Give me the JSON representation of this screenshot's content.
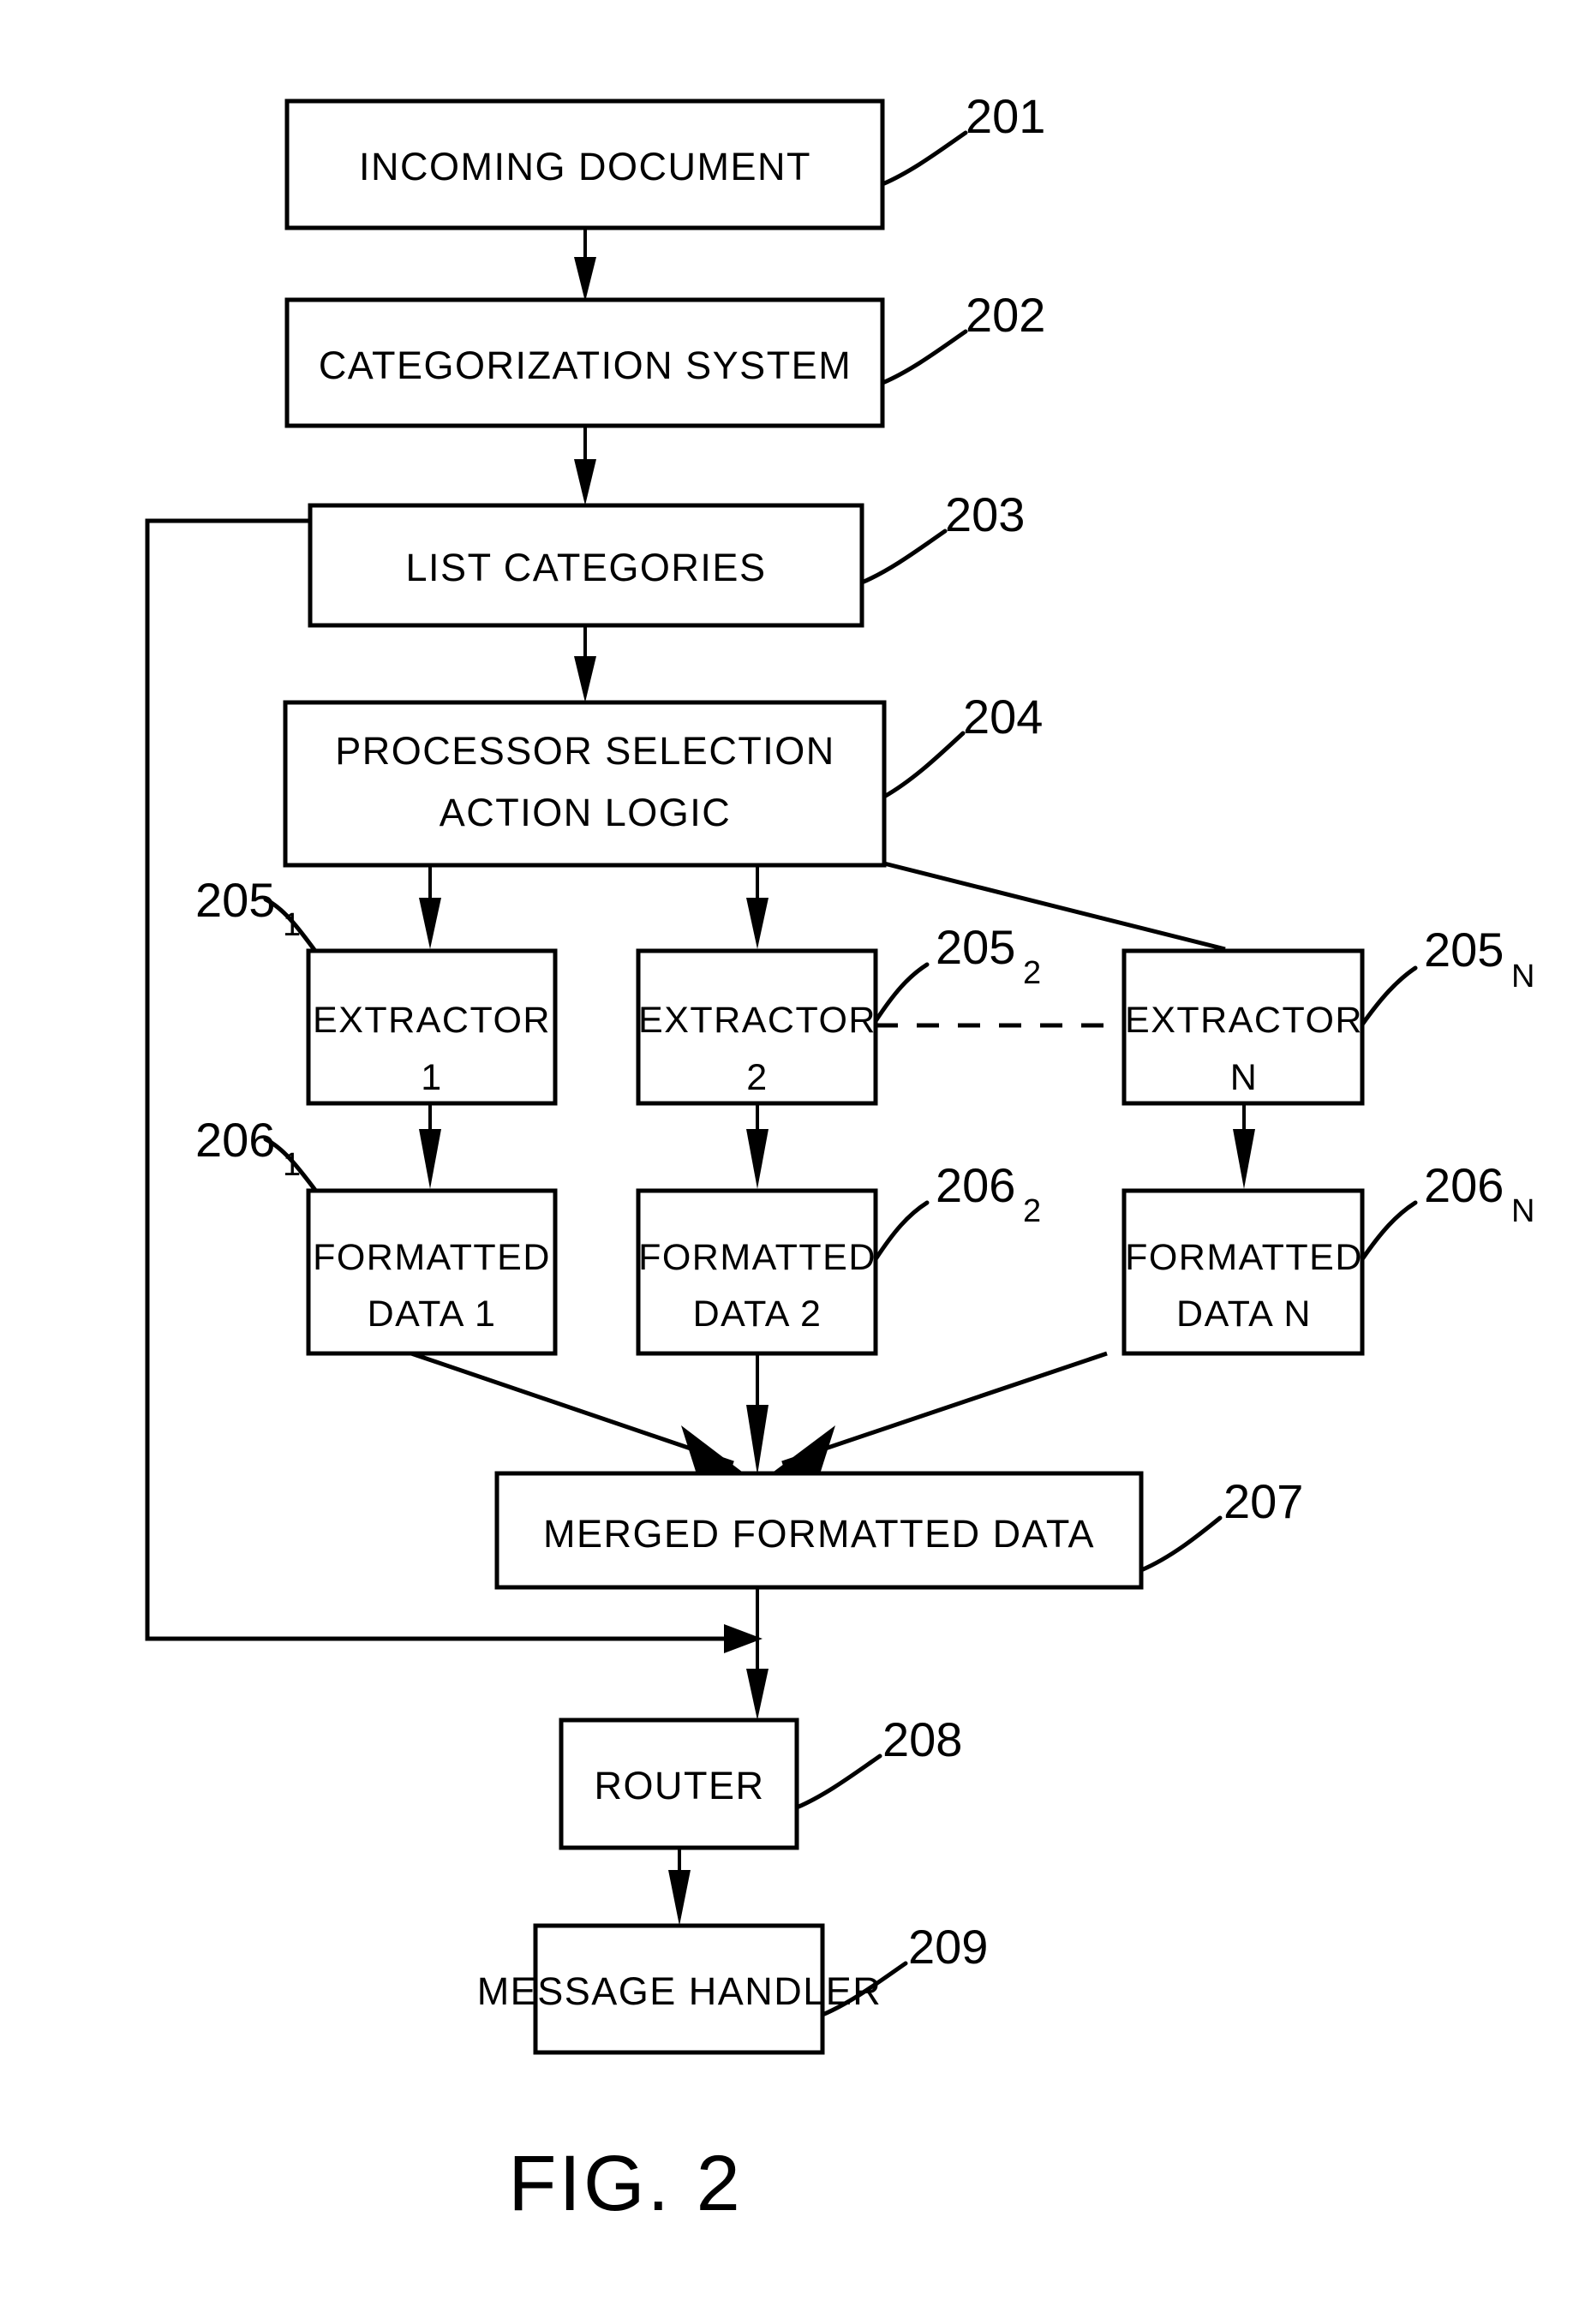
{
  "figure": {
    "caption": "FIG. 2"
  },
  "nodes": [
    {
      "id": "n201",
      "ref": "201",
      "ref_sub": "",
      "lines": [
        "INCOMING  DOCUMENT"
      ]
    },
    {
      "id": "n202",
      "ref": "202",
      "ref_sub": "",
      "lines": [
        "CATEGORIZATION  SYSTEM"
      ]
    },
    {
      "id": "n203",
      "ref": "203",
      "ref_sub": "",
      "lines": [
        "LIST  CATEGORIES"
      ]
    },
    {
      "id": "n204",
      "ref": "204",
      "ref_sub": "",
      "lines": [
        "PROCESSOR  SELECTION",
        "ACTION  LOGIC"
      ]
    },
    {
      "id": "n205_1",
      "ref": "205",
      "ref_sub": "1",
      "lines": [
        "EXTRACTOR",
        "1"
      ]
    },
    {
      "id": "n205_2",
      "ref": "205",
      "ref_sub": "2",
      "lines": [
        "EXTRACTOR",
        "2"
      ]
    },
    {
      "id": "n205_n",
      "ref": "205",
      "ref_sub": "N",
      "lines": [
        "EXTRACTOR",
        "N"
      ]
    },
    {
      "id": "n206_1",
      "ref": "206",
      "ref_sub": "1",
      "lines": [
        "FORMATTED",
        "DATA  1"
      ]
    },
    {
      "id": "n206_2",
      "ref": "206",
      "ref_sub": "2",
      "lines": [
        "FORMATTED",
        "DATA  2"
      ]
    },
    {
      "id": "n206_n",
      "ref": "206",
      "ref_sub": "N",
      "lines": [
        "FORMATTED",
        "DATA  N"
      ]
    },
    {
      "id": "n207",
      "ref": "207",
      "ref_sub": "",
      "lines": [
        "MERGED  FORMATTED  DATA"
      ]
    },
    {
      "id": "n208",
      "ref": "208",
      "ref_sub": "",
      "lines": [
        "ROUTER"
      ]
    },
    {
      "id": "n209",
      "ref": "209",
      "ref_sub": "",
      "lines": [
        "MESSAGE  HANDLER"
      ]
    }
  ],
  "colors": {
    "ink": "#000000",
    "paper": "#ffffff"
  }
}
